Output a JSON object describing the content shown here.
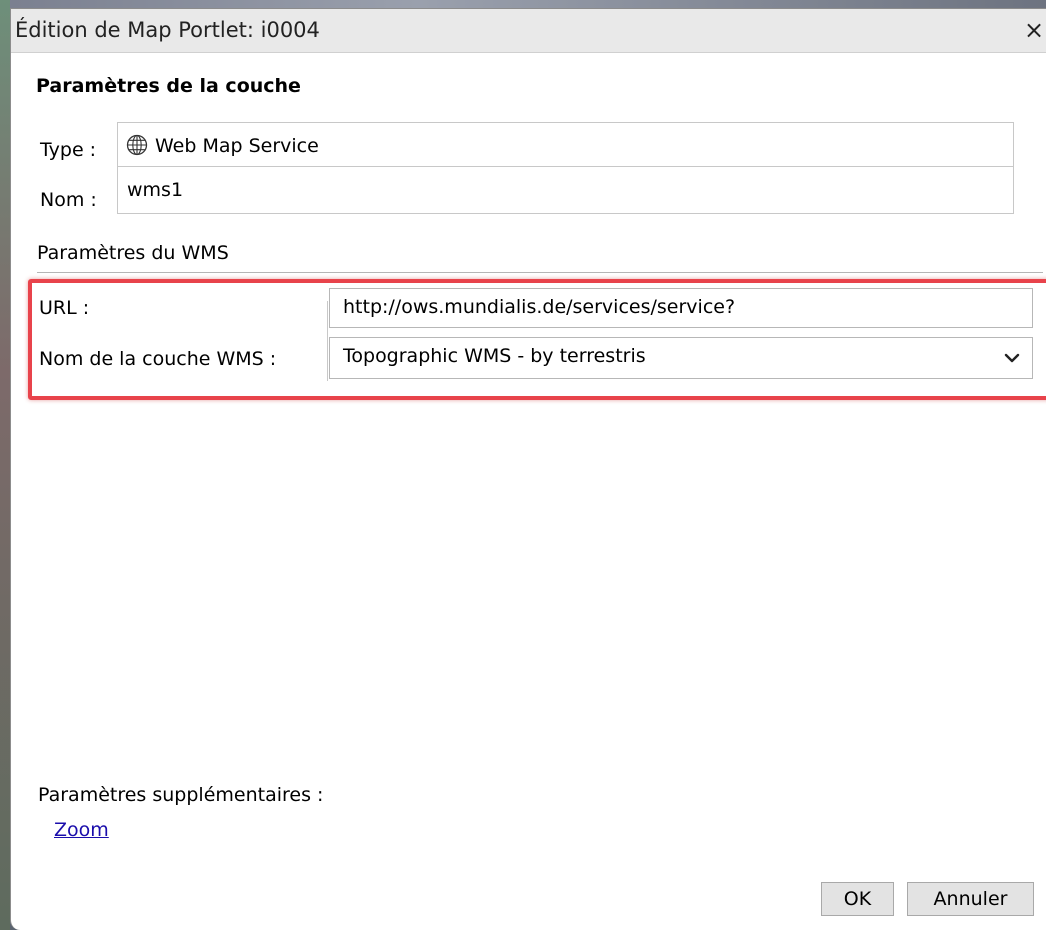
{
  "dialog": {
    "title": "Édition de Map Portlet: i0004",
    "close_label": "×"
  },
  "layer_params": {
    "section_title": "Paramètres de la couche",
    "type_label": "Type :",
    "type_value": "Web Map Service",
    "type_icon": "globe-icon",
    "name_label": "Nom :",
    "name_value": "wms1"
  },
  "wms": {
    "subhead": "Paramètres du WMS",
    "url_label": "URL :",
    "url_value": "http://ows.mundialis.de/services/service?",
    "layer_label": "Nom de la couche WMS :",
    "layer_selected": "Topographic WMS - by terrestris",
    "highlight_color": "#e8434b"
  },
  "extra": {
    "label": "Paramètres supplémentaires :",
    "zoom_link": "Zoom"
  },
  "buttons": {
    "ok": "OK",
    "cancel": "Annuler"
  }
}
